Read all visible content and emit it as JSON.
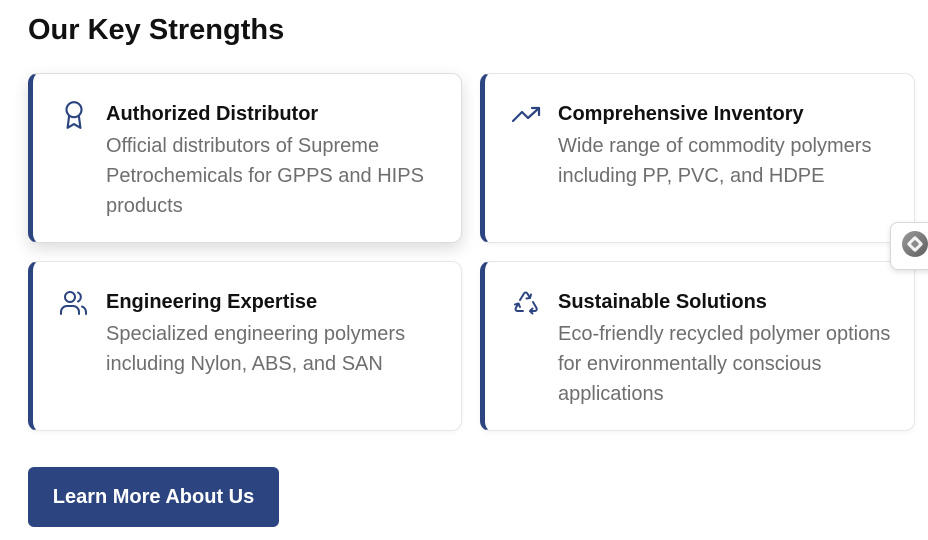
{
  "section": {
    "title": "Our Key Strengths"
  },
  "cards": [
    {
      "icon": "award-icon",
      "title": "Authorized Distributor",
      "description": "Official distributors of Supreme Petrochemicals for GPPS and HIPS products"
    },
    {
      "icon": "trending-up-icon",
      "title": "Comprehensive Inventory",
      "description": "Wide range of commodity polymers including PP, PVC, and HDPE"
    },
    {
      "icon": "users-icon",
      "title": "Engineering Expertise",
      "description": "Specialized engineering polymers including Nylon, ABS, and SAN"
    },
    {
      "icon": "recycle-icon",
      "title": "Sustainable Solutions",
      "description": "Eco-friendly recycled polymer options for environmentally conscious applications"
    }
  ],
  "cta": {
    "label": "Learn More About Us"
  },
  "floating_widget": {
    "icon": "diamond-widget-icon"
  },
  "colors": {
    "accent": "#2c4580",
    "title_text": "#111111",
    "body_text": "#6e6e6e"
  }
}
